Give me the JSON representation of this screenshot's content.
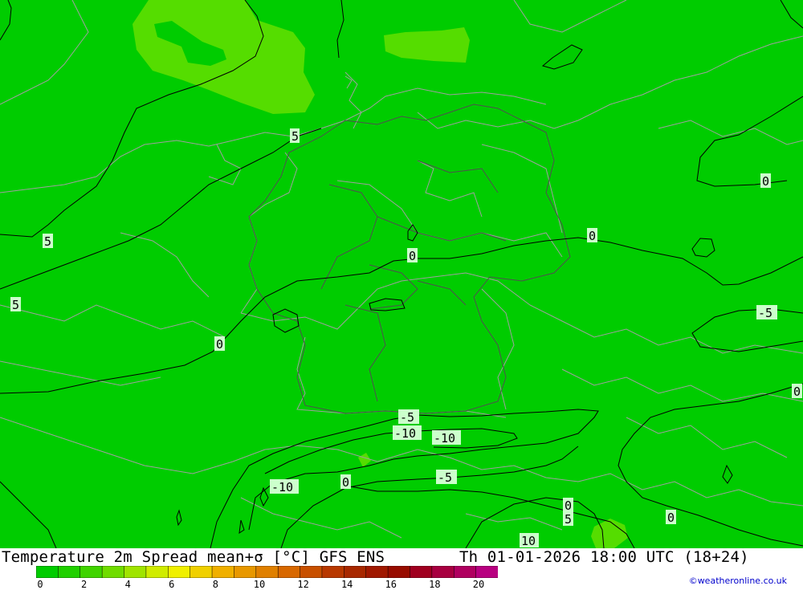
{
  "title": {
    "left": "Temperature 2m Spread mean+σ [°C] GFS ENS",
    "right": "Th 01-01-2026 18:00 UTC (18+24)"
  },
  "credit": "©weatheronline.co.uk",
  "colors": {
    "land": "#00cc00",
    "light_green": "#55dd00",
    "label_bg": "#ccffcc"
  },
  "legend": {
    "ticks": [
      "0",
      "2",
      "4",
      "6",
      "8",
      "10",
      "12",
      "14",
      "16",
      "18",
      "20"
    ],
    "swatches": [
      "#00cc00",
      "#20d000",
      "#40d400",
      "#70dc00",
      "#a0e400",
      "#d0ec00",
      "#f0f000",
      "#f0d000",
      "#f0b000",
      "#e89800",
      "#e08000",
      "#d86800",
      "#c85000",
      "#b83800",
      "#a82800",
      "#a01800",
      "#980c00",
      "#a00020",
      "#a80040",
      "#b00060",
      "#b80080"
    ]
  },
  "contour_labels": [
    {
      "id": "l1",
      "text": "5"
    },
    {
      "id": "l2",
      "text": "5"
    },
    {
      "id": "l3",
      "text": "5"
    },
    {
      "id": "l4",
      "text": "0"
    },
    {
      "id": "l5",
      "text": "0"
    },
    {
      "id": "l6",
      "text": "0"
    },
    {
      "id": "l7",
      "text": "0"
    },
    {
      "id": "l8",
      "text": "-5"
    },
    {
      "id": "l9",
      "text": "0"
    },
    {
      "id": "l10",
      "text": "-5"
    },
    {
      "id": "l11",
      "text": "-10"
    },
    {
      "id": "l12",
      "text": "-10"
    },
    {
      "id": "l13",
      "text": "-10"
    },
    {
      "id": "l14",
      "text": "0"
    },
    {
      "id": "l15",
      "text": "-5"
    },
    {
      "id": "l16",
      "text": "0"
    },
    {
      "id": "l17",
      "text": "5"
    },
    {
      "id": "l18",
      "text": "0"
    },
    {
      "id": "l19",
      "text": "10"
    }
  ]
}
